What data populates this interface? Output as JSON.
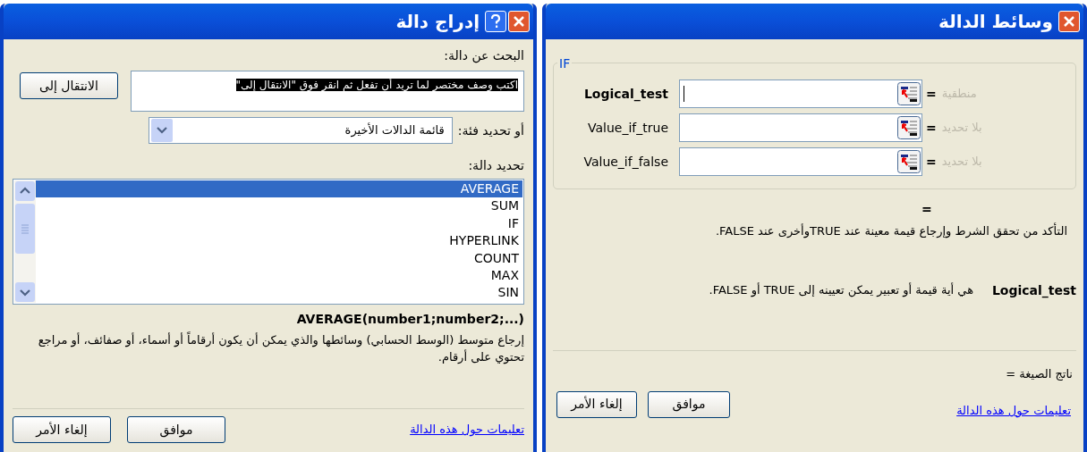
{
  "insert_function_dialog": {
    "title": "إدراج دالة",
    "search": {
      "label": "البحث عن دالة:",
      "value": "اكتب وصف مختصر لما تريد أن تفعل ثم انقر فوق \"الانتقال إلى\"",
      "selected": true
    },
    "go_button": "الانتقال إلى",
    "category": {
      "label": "أو تحديد فئة:",
      "value": "قائمة الدالات الأخيرة"
    },
    "function_list": {
      "label": "تحديد دالة:",
      "items": [
        {
          "name": "AVERAGE",
          "selected": true
        },
        {
          "name": "SUM",
          "selected": false
        },
        {
          "name": "IF",
          "selected": false
        },
        {
          "name": "HYPERLINK",
          "selected": false
        },
        {
          "name": "COUNT",
          "selected": false
        },
        {
          "name": "MAX",
          "selected": false
        },
        {
          "name": "SIN",
          "selected": false
        }
      ]
    },
    "signature": "AVERAGE(number1;number2;...)",
    "description": "إرجاع متوسط (الوسط الحسابي) وسائطها والذي يمكن أن يكون أرقاماً أو أسماء، أو صفائف، أو مراجع تحتوي على أرقام.",
    "help_link": "تعليمات حول هذه الدالة",
    "ok_button": "موافق",
    "cancel_button": "إلغاء الأمر"
  },
  "function_arguments_dialog": {
    "title": "وسائط الدالة",
    "function_name": "IF",
    "arguments": [
      {
        "name": "Logical_test",
        "active": true,
        "equals": "=",
        "hint": "منطقية"
      },
      {
        "name": "Value_if_true",
        "active": false,
        "equals": "=",
        "hint": "بلا تحديد"
      },
      {
        "name": "Value_if_false",
        "active": false,
        "equals": "=",
        "hint": "بلا تحديد"
      }
    ],
    "result": "=",
    "description": "التأكد من تحقق الشرط وإرجاع قيمة معينة عند TRUEوأخرى عند FALSE.",
    "argument_help": {
      "name": "Logical_test",
      "text": "هي أية قيمة أو تعبير يمكن تعيينه إلى TRUE أو FALSE."
    },
    "formula_result": "ناتج الصيغة =",
    "help_link": "تعليمات حول هذه الدالة",
    "ok_button": "موافق",
    "cancel_button": "إلغاء الأمر"
  }
}
